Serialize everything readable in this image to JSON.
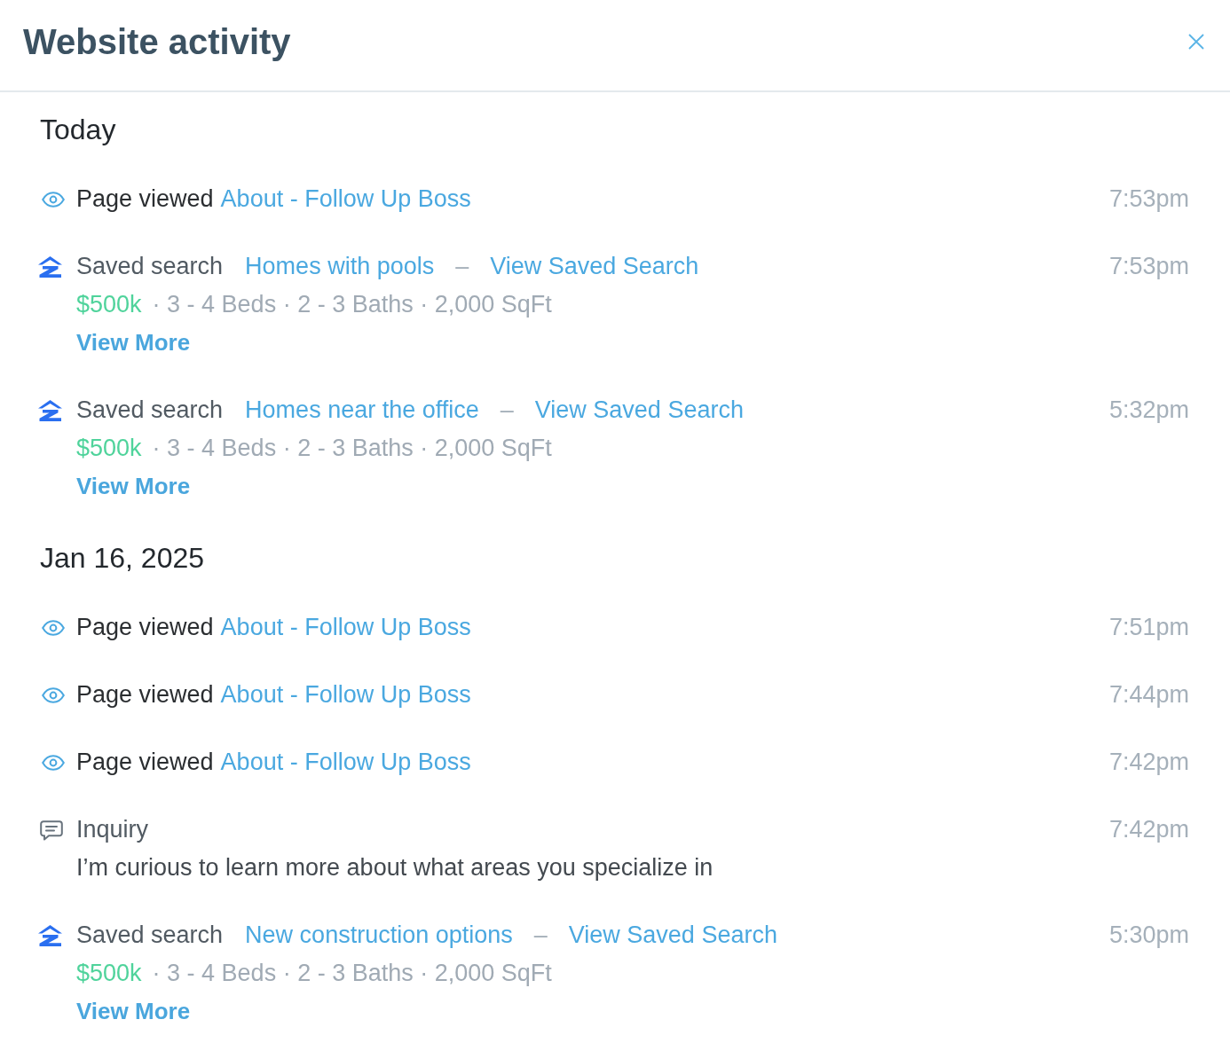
{
  "header": {
    "title": "Website activity"
  },
  "sections": [
    {
      "heading": "Today",
      "events": [
        {
          "kind": "page_view",
          "label": "Page viewed",
          "page": "About - Follow Up Boss",
          "time": "7:53pm"
        },
        {
          "kind": "saved_search",
          "label": "Saved search",
          "search_name": "Homes with pools",
          "separator": "–",
          "view_link": "View Saved Search",
          "price": "$500k",
          "criteria": "· 3 - 4 Beds · 2 - 3 Baths · 2,000 SqFt",
          "more_link": "View More",
          "time": "7:53pm"
        },
        {
          "kind": "saved_search",
          "label": "Saved search",
          "search_name": "Homes near the office",
          "separator": "–",
          "view_link": "View Saved Search",
          "price": "$500k",
          "criteria": "· 3 - 4 Beds · 2 - 3 Baths · 2,000 SqFt",
          "more_link": "View More",
          "time": "5:32pm"
        }
      ]
    },
    {
      "heading": "Jan 16, 2025",
      "events": [
        {
          "kind": "page_view",
          "label": "Page viewed",
          "page": "About - Follow Up Boss",
          "time": "7:51pm"
        },
        {
          "kind": "page_view",
          "label": "Page viewed",
          "page": "About - Follow Up Boss",
          "time": "7:44pm"
        },
        {
          "kind": "page_view",
          "label": "Page viewed",
          "page": "About - Follow Up Boss",
          "time": "7:42pm"
        },
        {
          "kind": "inquiry",
          "label": "Inquiry",
          "message": "I’m curious to learn more about what areas you specialize in",
          "time": "7:42pm"
        },
        {
          "kind": "saved_search",
          "label": "Saved search",
          "search_name": "New construction options",
          "separator": "–",
          "view_link": "View Saved Search",
          "price": "$500k",
          "criteria": "· 3 - 4 Beds · 2 - 3 Baths · 2,000 SqFt",
          "more_link": "View More",
          "time": "5:30pm"
        }
      ]
    }
  ]
}
